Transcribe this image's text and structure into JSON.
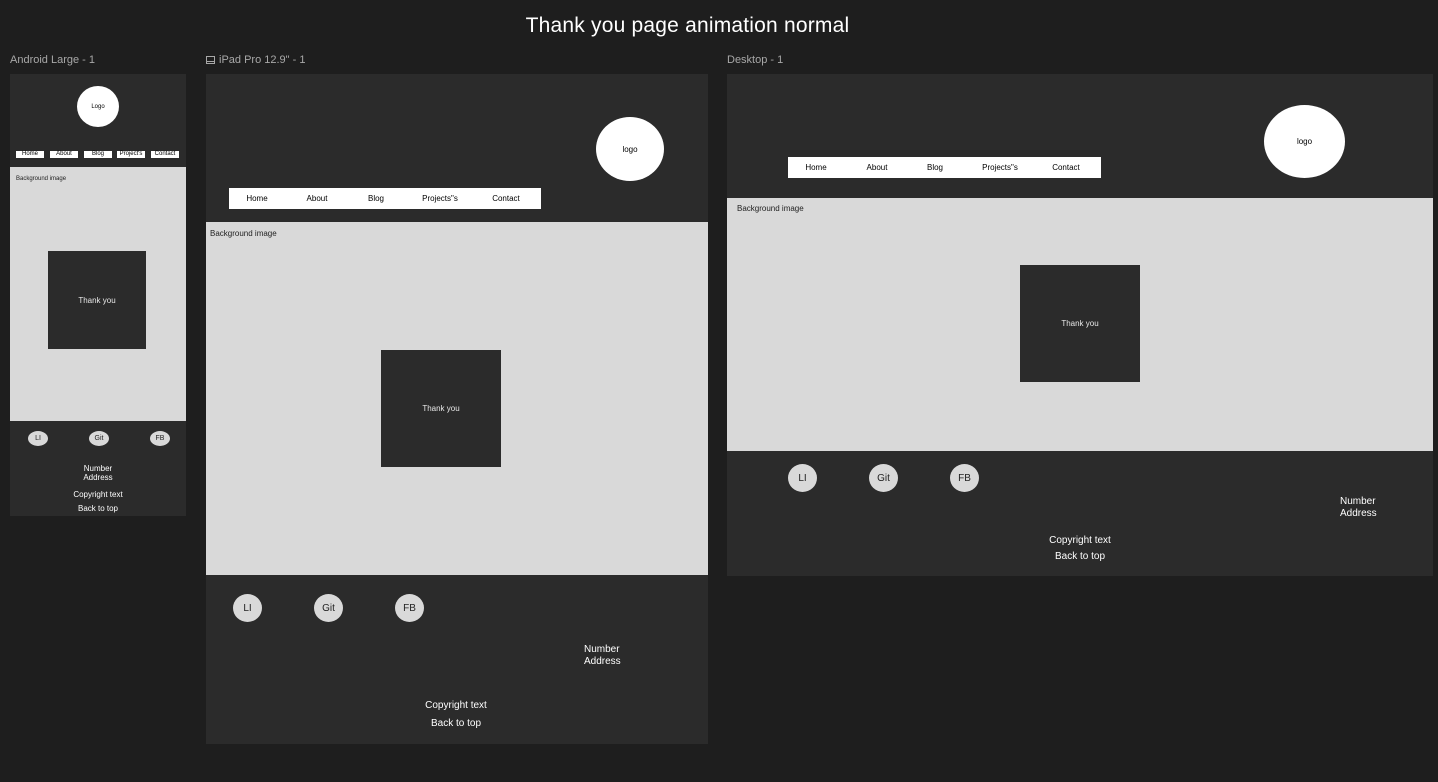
{
  "canvas": {
    "title": "Thank you page animation normal"
  },
  "frames": {
    "android": {
      "label": "Android Large - 1",
      "logo": "Logo",
      "nav": [
        "Home",
        "About",
        "Blog",
        "Project's",
        "Contact"
      ],
      "hero_label": "Background image",
      "thank_you": "Thank you",
      "social": [
        "LI",
        "Git",
        "FB"
      ],
      "number": "Number",
      "address": "Address",
      "copyright": "Copyright text",
      "back_to_top": "Back to top"
    },
    "ipad": {
      "label": "iPad Pro 12.9\" - 1",
      "icon": "tablet-icon",
      "logo": "logo",
      "nav": [
        "Home",
        "About",
        "Blog",
        "Projects\"s",
        "Contact"
      ],
      "hero_label": "Background image",
      "thank_you": "Thank you",
      "social": [
        "LI",
        "Git",
        "FB"
      ],
      "number": "Number",
      "address": "Address",
      "copyright": "Copyright text",
      "back_to_top": "Back to top"
    },
    "desktop": {
      "label": "Desktop - 1",
      "logo": "logo",
      "nav": [
        "Home",
        "About",
        "Blog",
        "Projects\"s",
        "Contact"
      ],
      "hero_label": "Background image",
      "thank_you": "Thank you",
      "social": [
        "LI",
        "Git",
        "FB"
      ],
      "number": "Number",
      "address": "Address",
      "copyright": "Copyright text",
      "back_to_top": "Back to top"
    }
  },
  "colors": {
    "canvas_bg": "#1e1e1e",
    "frame_bg": "#2b2b2b",
    "hero_bg": "#d9d9d9",
    "white": "#ffffff"
  }
}
